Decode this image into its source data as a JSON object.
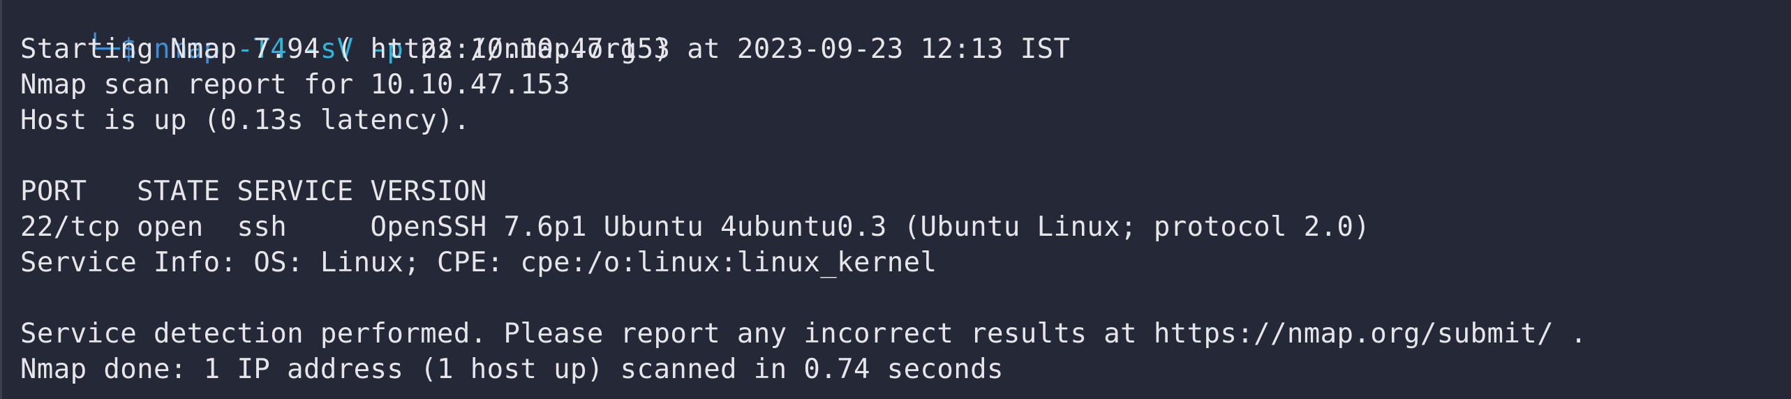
{
  "prompt": {
    "branch": "└─",
    "symbol": "$",
    "command": "nmap",
    "flags": "-T4 -sV -p",
    "args": "22 10.10.47.153"
  },
  "output_lines": [
    "Starting Nmap 7.94 ( https://nmap.org ) at 2023-09-23 12:13 IST",
    "Nmap scan report for 10.10.47.153",
    "Host is up (0.13s latency).",
    "",
    "PORT   STATE SERVICE VERSION",
    "22/tcp open  ssh     OpenSSH 7.6p1 Ubuntu 4ubuntu0.3 (Ubuntu Linux; protocol 2.0)",
    "Service Info: OS: Linux; CPE: cpe:/o:linux:linux_kernel",
    "",
    "Service detection performed. Please report any incorrect results at https://nmap.org/submit/ .",
    "Nmap done: 1 IP address (1 host up) scanned in 0.74 seconds"
  ]
}
